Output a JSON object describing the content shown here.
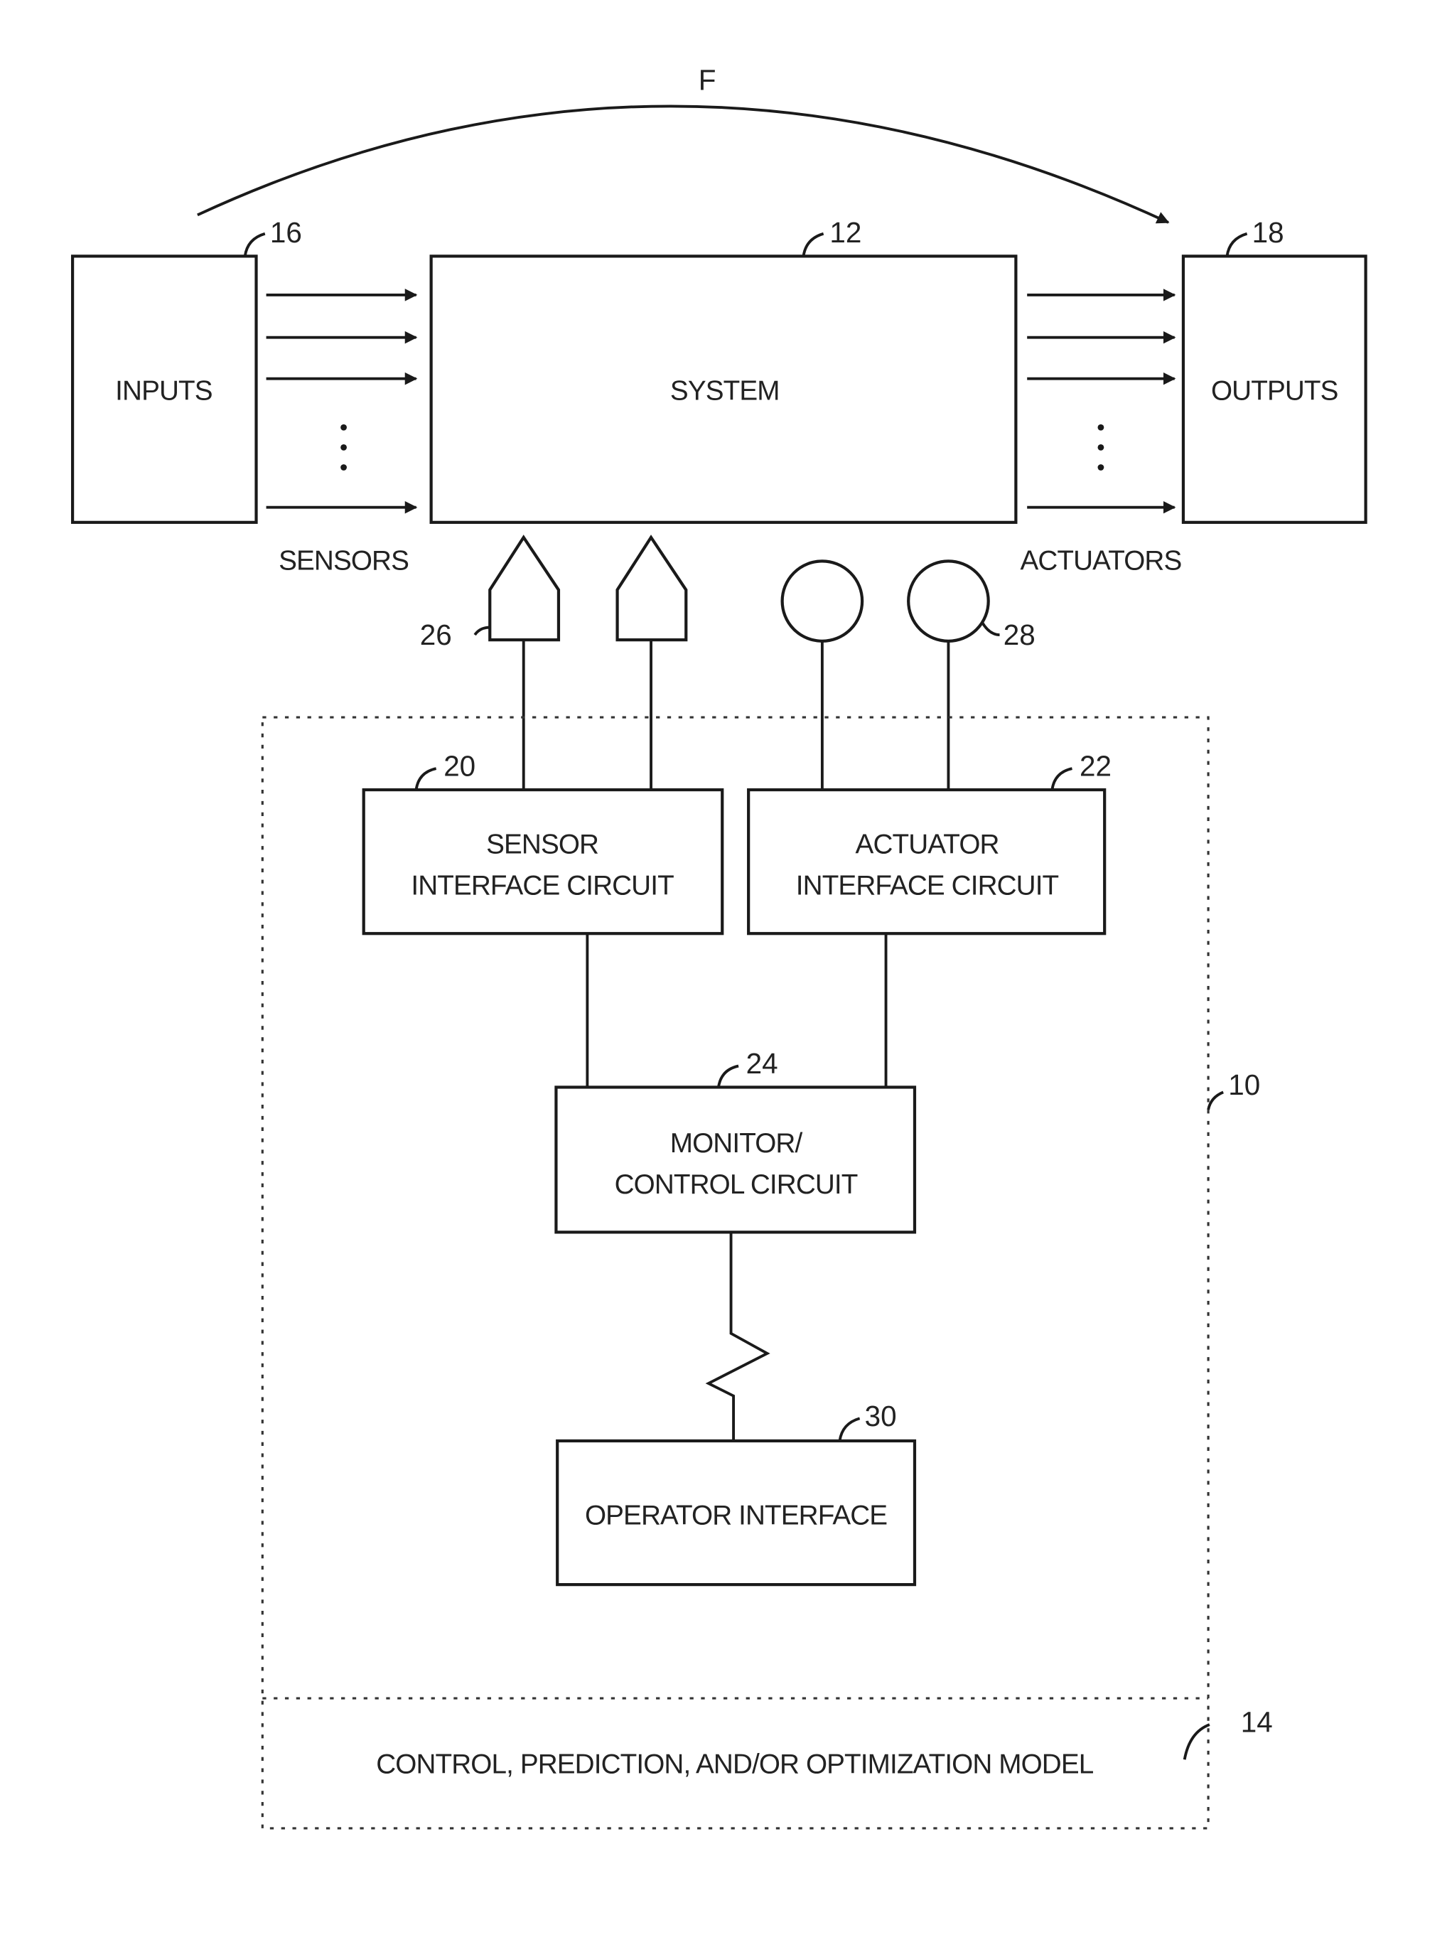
{
  "figure": {
    "flow_label": "F",
    "blocks": {
      "inputs": {
        "label": "INPUTS",
        "ref": "16"
      },
      "system": {
        "label": "SYSTEM",
        "ref": "12"
      },
      "outputs": {
        "label": "OUTPUTS",
        "ref": "18"
      },
      "sensor_interface": {
        "line1": "SENSOR",
        "line2": "INTERFACE CIRCUIT",
        "ref": "20"
      },
      "actuator_interface": {
        "line1": "ACTUATOR",
        "line2": "INTERFACE CIRCUIT",
        "ref": "22"
      },
      "monitor_control": {
        "line1": "MONITOR/",
        "line2": "CONTROL CIRCUIT",
        "ref": "24"
      },
      "operator_interface": {
        "label": "OPERATOR INTERFACE",
        "ref": "30"
      },
      "control_model": {
        "label": "CONTROL, PREDICTION, AND/OR OPTIMIZATION MODEL",
        "ref": "14"
      }
    },
    "labels": {
      "sensors": "SENSORS",
      "actuators": "ACTUATORS",
      "sensor_ref": "26",
      "actuator_ref": "28",
      "controller_ref": "10"
    }
  }
}
